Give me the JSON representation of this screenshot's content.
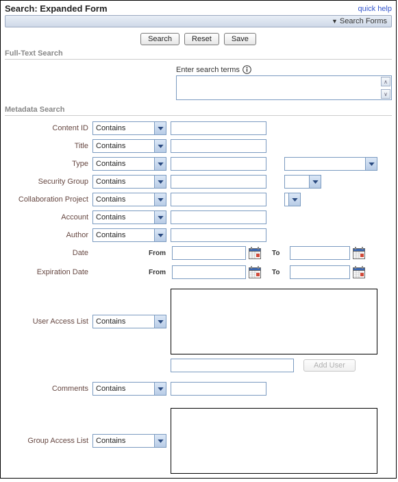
{
  "header": {
    "title": "Search: Expanded Form",
    "quick_help": "quick help",
    "search_forms": "Search Forms"
  },
  "buttons": {
    "search": "Search",
    "reset": "Reset",
    "save": "Save"
  },
  "sections": {
    "fulltext": "Full-Text Search",
    "metadata": "Metadata Search"
  },
  "fulltext": {
    "label": "Enter search terms",
    "value": ""
  },
  "operators": {
    "contains": "Contains"
  },
  "fields": {
    "content_id": {
      "label": "Content ID",
      "op": "Contains",
      "value": ""
    },
    "title": {
      "label": "Title",
      "op": "Contains",
      "value": ""
    },
    "type": {
      "label": "Type",
      "op": "Contains",
      "value": "",
      "extra": ""
    },
    "security_group": {
      "label": "Security Group",
      "op": "Contains",
      "value": "",
      "extra": ""
    },
    "collab_project": {
      "label": "Collaboration Project",
      "op": "Contains",
      "value": "",
      "extra": ""
    },
    "account": {
      "label": "Account",
      "op": "Contains",
      "value": ""
    },
    "author": {
      "label": "Author",
      "op": "Contains",
      "value": ""
    },
    "date": {
      "label": "Date",
      "from_label": "From",
      "to_label": "To",
      "from": "",
      "to": ""
    },
    "exp_date": {
      "label": "Expiration Date",
      "from_label": "From",
      "to_label": "To",
      "from": "",
      "to": ""
    },
    "user_access": {
      "label": "User Access List",
      "op": "Contains",
      "value": "",
      "add_user_input": "",
      "add_user_btn": "Add User"
    },
    "comments": {
      "label": "Comments",
      "op": "Contains",
      "value": ""
    },
    "group_access": {
      "label": "Group Access List",
      "op": "Contains",
      "value": ""
    }
  }
}
